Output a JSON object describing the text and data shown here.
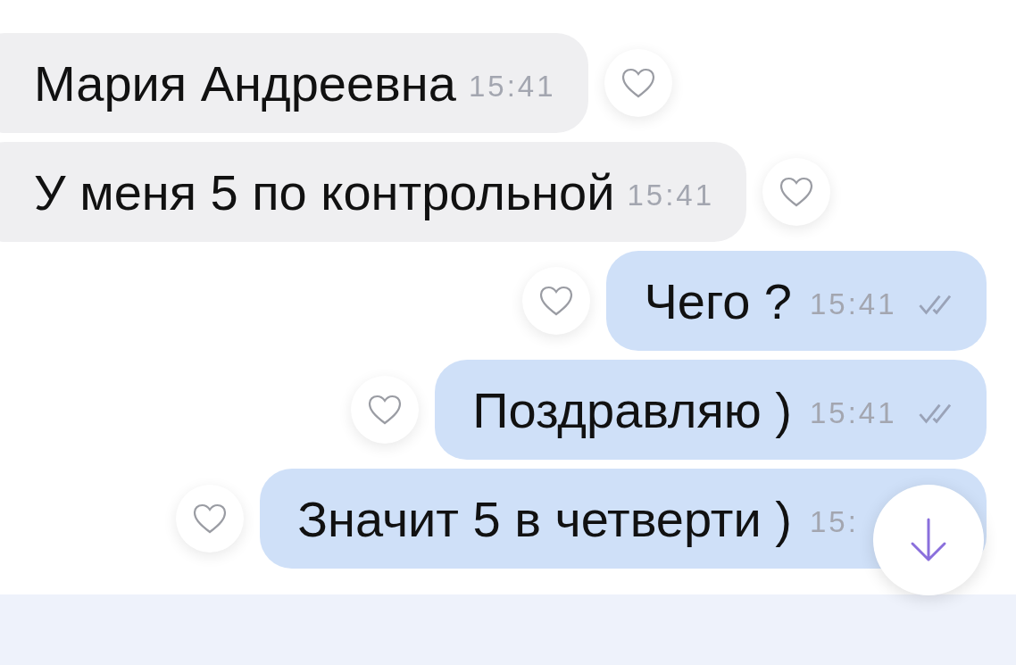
{
  "messages": [
    {
      "kind": "incoming",
      "text": "Мария Андреевна",
      "time": "15:41",
      "liked": false
    },
    {
      "kind": "incoming",
      "text": "У меня 5 по контрольной",
      "time": "15:41",
      "liked": false
    },
    {
      "kind": "outgoing",
      "text": "Чего ?",
      "time": "15:41",
      "read": true,
      "liked": false
    },
    {
      "kind": "outgoing",
      "text": "Поздравляю )",
      "time": "15:41",
      "read": true,
      "liked": false
    },
    {
      "kind": "outgoing",
      "text": "Значит 5 в четверти )",
      "time": "15:",
      "liked": false
    }
  ]
}
